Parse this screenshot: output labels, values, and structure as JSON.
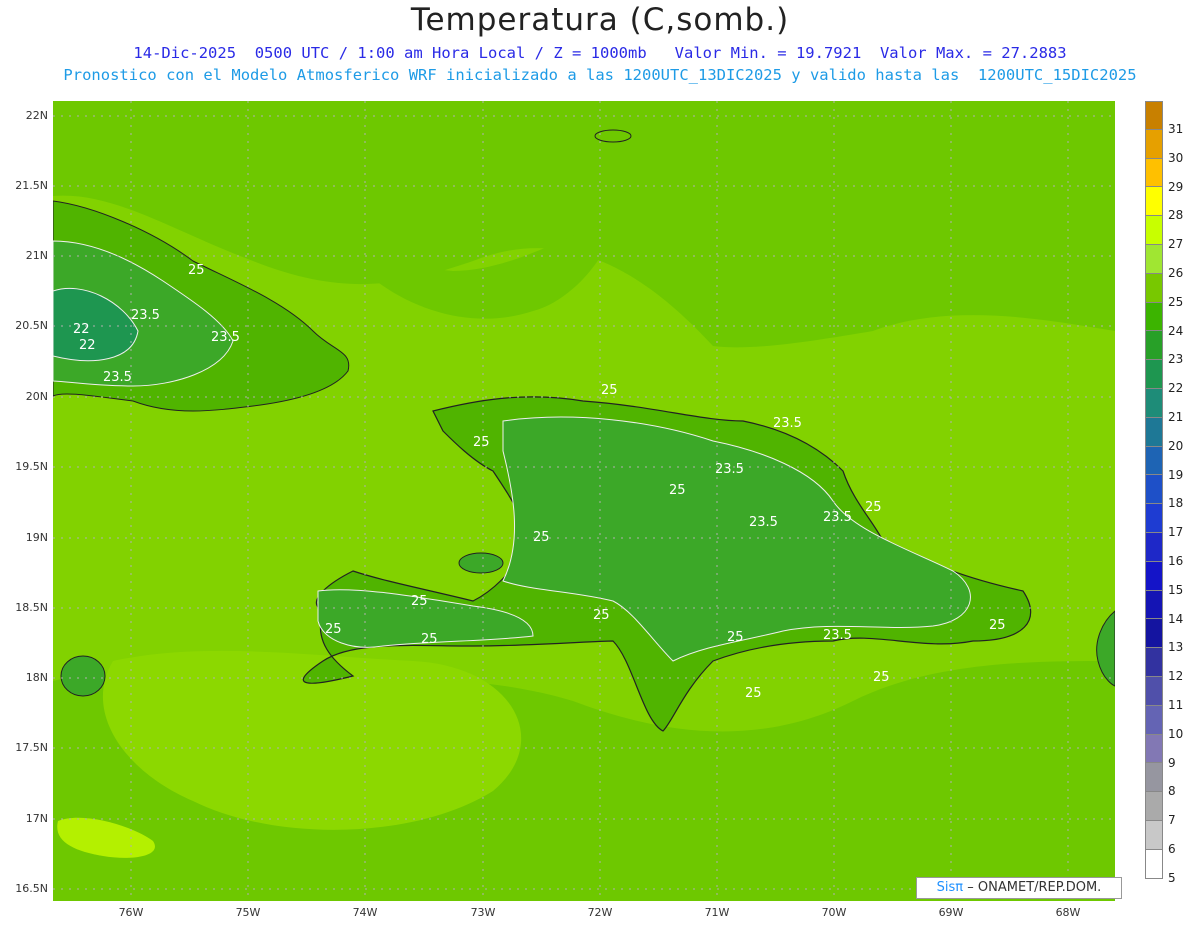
{
  "header": {
    "title": "Temperatura (C,somb.)",
    "line1": "14-Dic-2025  0500 UTC / 1:00 am Hora Local / Z = 1000mb   Valor Min. = 19.7921  Valor Max. = 27.2883",
    "line2": "Pronostico con el Modelo Atmosferico WRF inicializado a las 1200UTC_13DIC2025 y valido hasta las  1200UTC_15DIC2025"
  },
  "axes": {
    "lat_labels": [
      "22N",
      "21.5N",
      "21N",
      "20.5N",
      "20N",
      "19.5N",
      "19N",
      "18.5N",
      "18N",
      "17.5N",
      "17N",
      "16.5N"
    ],
    "lon_labels": [
      "76W",
      "75W",
      "74W",
      "73W",
      "72W",
      "71W",
      "70W",
      "69W",
      "68W"
    ]
  },
  "contour_labels": [
    "25",
    "25",
    "25",
    "25",
    "25",
    "25",
    "25",
    "25",
    "25",
    "25",
    "25",
    "25",
    "25",
    "25",
    "22",
    "22",
    "23.5",
    "23.5",
    "23.5",
    "23.5",
    "23.5",
    "23.5",
    "23.5",
    "23.5"
  ],
  "colorbar": {
    "levels": [
      "31",
      "30",
      "29",
      "28",
      "27",
      "26",
      "25",
      "24",
      "23",
      "22",
      "21",
      "20",
      "19",
      "18",
      "17",
      "16",
      "15",
      "14",
      "13",
      "12",
      "11",
      "10",
      "9",
      "8",
      "7",
      "6",
      "5"
    ],
    "colors": [
      "#c88000",
      "#e6a000",
      "#ffc000",
      "#ffff00",
      "#c8ff00",
      "#a0e632",
      "#78c800",
      "#3cb400",
      "#28a028",
      "#1e9650",
      "#1e8c78",
      "#1e7896",
      "#1e64b4",
      "#1e50c8",
      "#1e3cd2",
      "#1e28c8",
      "#1414c8",
      "#1414b4",
      "#1414a0",
      "#3232a0",
      "#5050aa",
      "#6464b4",
      "#8278b4",
      "#9696a0",
      "#aaaaaa",
      "#c8c8c8",
      "#ffffff"
    ]
  },
  "credit": {
    "sis": "Sisπ",
    "text": "– ONAMET/REP.DOM."
  }
}
